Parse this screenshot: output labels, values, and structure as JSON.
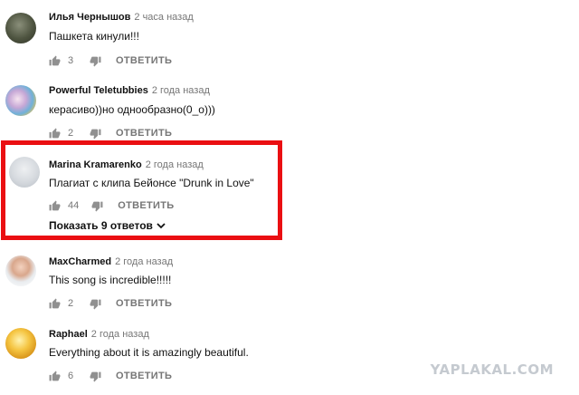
{
  "comments": [
    {
      "author": "Илья Чернышов",
      "time": "2 часа назад",
      "text": "Пашкета кинули!!!",
      "likes": "3",
      "reply": "ОТВЕТИТЬ"
    },
    {
      "author": "Powerful Teletubbies",
      "time": "2 года назад",
      "text": "керасиво))но однообразно(0_о)))",
      "likes": "2",
      "reply": "ОТВЕТИТЬ"
    },
    {
      "author": "Marina Kramarenko",
      "time": "2 года назад",
      "text": "Плагиат с клипа Бейонсе \"Drunk in Love\"",
      "likes": "44",
      "reply": "ОТВЕТИТЬ",
      "replies_label": "Показать 9 ответов"
    },
    {
      "author": "MaxCharmed",
      "time": "2 года назад",
      "text": "This song is incredible!!!!!",
      "likes": "2",
      "reply": "ОТВЕТИТЬ"
    },
    {
      "author": "Raphael",
      "time": "2 года назад",
      "text": "Everything about it is amazingly beautiful.",
      "likes": "6",
      "reply": "ОТВЕТИТЬ"
    }
  ],
  "watermark": "YAPLAKAL.COM",
  "colors": {
    "highlight": "#ea0f12",
    "meta": "#767676",
    "text": "#111111",
    "watermark": "#c5cad0"
  },
  "icons": [
    "thumb-up-icon",
    "thumb-down-icon",
    "chevron-down-icon"
  ]
}
